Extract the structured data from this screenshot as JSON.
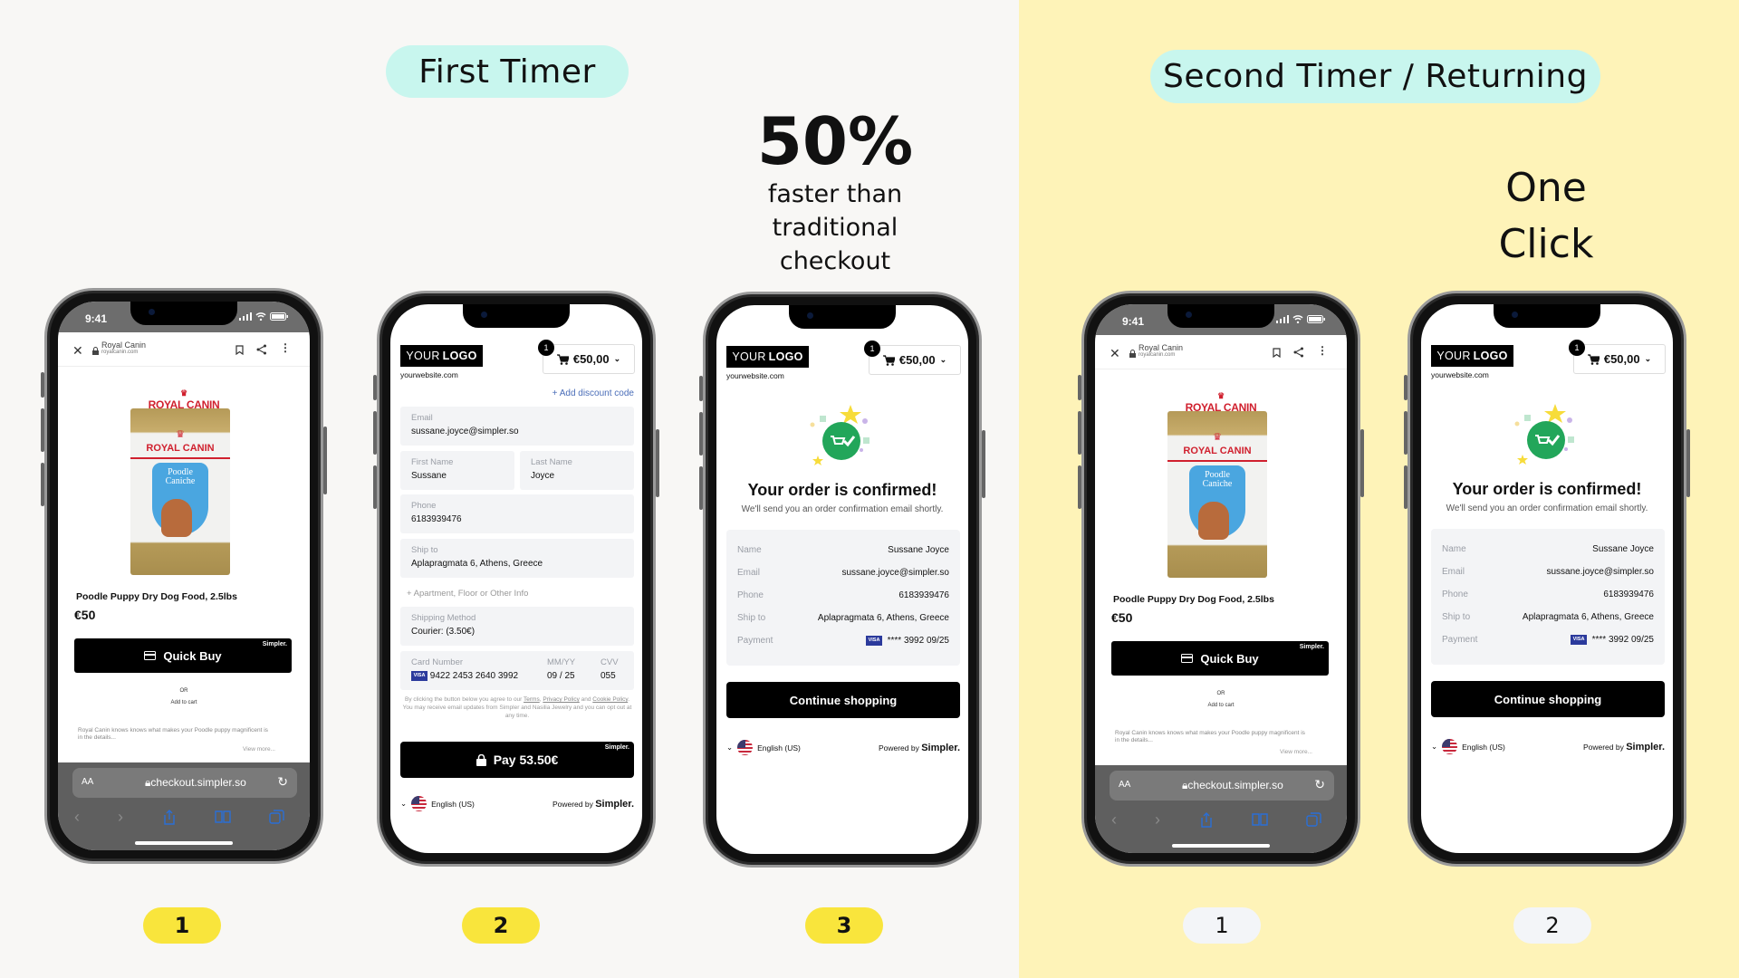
{
  "sections": {
    "first_timer": {
      "label": "First Timer",
      "steps": [
        "1",
        "2",
        "3"
      ],
      "badge_color": "#f9e53c"
    },
    "second_timer": {
      "label": "Second Timer / Returning",
      "steps": [
        "1",
        "2"
      ],
      "badge_color": "#f3f5f8"
    }
  },
  "callouts": {
    "speed": {
      "value": "50%",
      "lines": [
        "faster than",
        "traditional",
        "checkout"
      ]
    },
    "one_click": {
      "lines": [
        "One",
        "Click"
      ]
    }
  },
  "colors": {
    "pill": "#c8f6ee",
    "left_bg": "#f8f7f5",
    "right_bg": "#fef3b8",
    "success_green": "#22a65a"
  },
  "product_page": {
    "status_time": "9:41",
    "site_title": "Royal Canin",
    "site_url": "royalcanin.com",
    "brand_logo": "ROYAL CANIN",
    "package_text": [
      "ROYAL CANIN",
      "Poodle",
      "Caniche"
    ],
    "product_title": "Poodle Puppy Dry Dog Food, 2.5lbs",
    "price": "€50",
    "quick_buy_label": "Quick Buy",
    "simpler_mark": "Simpler.",
    "or_label": "OR",
    "add_to_cart_label": "Add to cart",
    "description": "Royal Canin knows knows what makes your Poodle puppy magnificent is in the details...",
    "view_more": "View more...",
    "text_size_label": "AA",
    "address_bar": "checkout.simpler.so"
  },
  "checkout": {
    "logo_light": "YOUR",
    "logo_bold": "LOGO",
    "website": "yourwebsite.com",
    "cart_count": "1",
    "cart_total": "€50,00",
    "add_discount": "+ Add discount code",
    "email": {
      "label": "Email",
      "value": "sussane.joyce@simpler.so"
    },
    "first_name": {
      "label": "First Name",
      "value": "Sussane"
    },
    "last_name": {
      "label": "Last Name",
      "value": "Joyce"
    },
    "phone": {
      "label": "Phone",
      "value": "6183939476"
    },
    "ship_to": {
      "label": "Ship to",
      "value": "Aplapragmata 6, Athens, Greece"
    },
    "apartment": "+ Apartment, Floor or Other Info",
    "shipping_method": {
      "label": "Shipping Method",
      "value": "Courier: (3.50€)"
    },
    "card": {
      "number_label": "Card Number",
      "number": "9422 2453 2640 3992",
      "exp_label": "MM/YY",
      "exp": "09 / 25",
      "cvv_label": "CVV",
      "cvv": "055",
      "brand": "VISA"
    },
    "legal": {
      "pre": "By clicking the button below you agree to our ",
      "terms": "Terms",
      "privacy": "Privacy Policy",
      "and": " and ",
      "cookie": "Cookie Policy",
      "post": ". You may receive email updates from Simpler and Nasilia Jewelry and you can opt out at any time."
    },
    "pay_label": "Pay 53.50€",
    "simpler_mark": "Simpler.",
    "language": "English (US)",
    "powered_by": "Powered by",
    "powered_brand": "Simpler."
  },
  "confirmation": {
    "title": "Your order is confirmed!",
    "subtitle": "We'll send you an order confirmation email shortly.",
    "rows": [
      {
        "key": "Name",
        "value": "Sussane Joyce"
      },
      {
        "key": "Email",
        "value": "sussane.joyce@simpler.so"
      },
      {
        "key": "Phone",
        "value": "6183939476"
      },
      {
        "key": "Ship to",
        "value": "Aplapragmata 6, Athens, Greece"
      },
      {
        "key": "Payment",
        "value": "**** 3992  09/25",
        "brand": "VISA"
      }
    ],
    "continue_label": "Continue shopping"
  }
}
